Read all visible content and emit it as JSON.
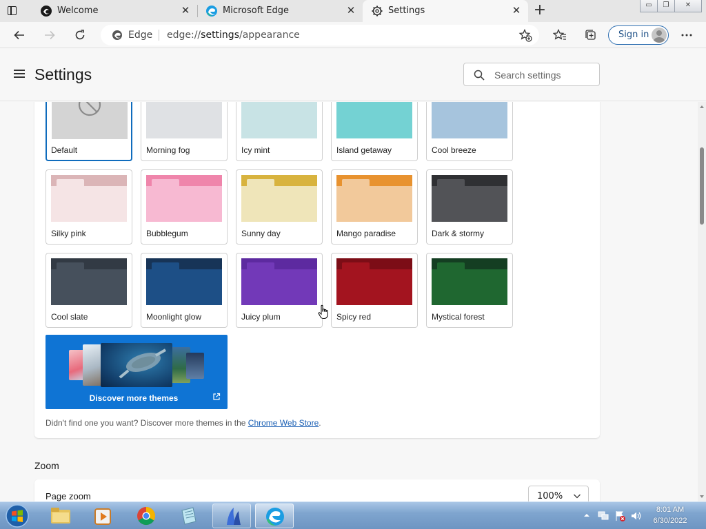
{
  "browser": {
    "tabs": [
      {
        "title": "Welcome",
        "active": false
      },
      {
        "title": "Microsoft Edge",
        "active": false
      },
      {
        "title": "Settings",
        "active": true
      }
    ],
    "close_glyph": "✕",
    "new_tab_glyph": "+",
    "window_controls": {
      "minimize": "▭",
      "maximize": "❐",
      "close": "✕"
    },
    "address": {
      "site_name": "Edge",
      "url_scheme": "edge://",
      "url_host": "settings",
      "url_path": "/appearance"
    },
    "sign_in_label": "Sign in"
  },
  "settings": {
    "title": "Settings",
    "search_placeholder": "Search settings"
  },
  "themes": [
    {
      "name": "Default",
      "selected": true,
      "top": "#d4d4d4",
      "body": "#d4d4d4",
      "tab": "#d4d4d4"
    },
    {
      "name": "Morning fog",
      "selected": false,
      "top": "#dfe1e4",
      "body": "#dfe1e4",
      "tab": "#dfe1e4"
    },
    {
      "name": "Icy mint",
      "selected": false,
      "top": "#c8e3e5",
      "body": "#c8e3e5",
      "tab": "#c8e3e5"
    },
    {
      "name": "Island getaway",
      "selected": false,
      "top": "#74d2d3",
      "body": "#74d2d3",
      "tab": "#74d2d3"
    },
    {
      "name": "Cool breeze",
      "selected": false,
      "top": "#a6c4dd",
      "body": "#a6c4dd",
      "tab": "#a6c4dd"
    },
    {
      "name": "Silky pink",
      "selected": false,
      "top": "#dbb5b7",
      "body": "#f5e4e5",
      "tab": "#f5e4e5"
    },
    {
      "name": "Bubblegum",
      "selected": false,
      "top": "#ef85ab",
      "body": "#f7b9d2",
      "tab": "#f7b9d2"
    },
    {
      "name": "Sunny day",
      "selected": false,
      "top": "#d8b33e",
      "body": "#efe5b9",
      "tab": "#efe5b9"
    },
    {
      "name": "Mango paradise",
      "selected": false,
      "top": "#e8922f",
      "body": "#f2c99b",
      "tab": "#f2c99b"
    },
    {
      "name": "Dark & stormy",
      "selected": false,
      "top": "#2f3033",
      "body": "#525357",
      "tab": "#525357"
    },
    {
      "name": "Cool slate",
      "selected": false,
      "top": "#323a44",
      "body": "#46505c",
      "tab": "#46505c"
    },
    {
      "name": "Moonlight glow",
      "selected": false,
      "top": "#173457",
      "body": "#1d4f86",
      "tab": "#1d4f86"
    },
    {
      "name": "Juicy plum",
      "selected": false,
      "top": "#5d2aa0",
      "body": "#7239b8",
      "tab": "#7239b8"
    },
    {
      "name": "Spicy red",
      "selected": false,
      "top": "#7c0d16",
      "body": "#a3141f",
      "tab": "#a3141f"
    },
    {
      "name": "Mystical forest",
      "selected": false,
      "top": "#143e22",
      "body": "#1f6730",
      "tab": "#1f6730"
    }
  ],
  "discover": {
    "label": "Discover more themes"
  },
  "hint": {
    "text": "Didn't find one you want? Discover more themes in the ",
    "link": "Chrome Web Store",
    "end": "."
  },
  "zoom": {
    "section_title": "Zoom",
    "label": "Page zoom",
    "value": "100%"
  },
  "taskbar": {
    "time": "8:01 AM",
    "date": "6/30/2022"
  },
  "colors": {
    "accent": "#0f6cbd",
    "discover_bg": "#0f74d4",
    "link": "#1a5fb4"
  }
}
